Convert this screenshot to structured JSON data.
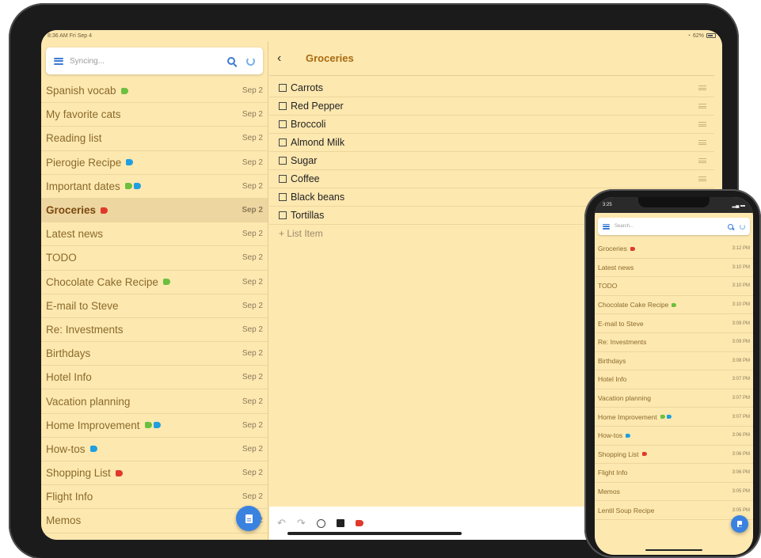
{
  "tablet": {
    "status": {
      "time": "8:36 AM  Fri Sep 4",
      "battery": "62%"
    },
    "search": {
      "placeholder": "Syncing..."
    },
    "notes": [
      {
        "title": "Spanish vocab",
        "date": "Sep 2",
        "tags": [
          "#6cbf3f"
        ]
      },
      {
        "title": "My favorite cats",
        "date": "Sep 2",
        "tags": []
      },
      {
        "title": "Reading list",
        "date": "Sep 2",
        "tags": []
      },
      {
        "title": "Pierogie Recipe",
        "date": "Sep 2",
        "tags": [
          "#1f9fe0"
        ]
      },
      {
        "title": "Important dates",
        "date": "Sep 2",
        "tags": [
          "#6cbf3f",
          "#1f9fe0"
        ]
      },
      {
        "title": "Groceries",
        "date": "Sep 2",
        "tags": [
          "#e0392b"
        ],
        "selected": true
      },
      {
        "title": "Latest news",
        "date": "Sep 2",
        "tags": []
      },
      {
        "title": "TODO",
        "date": "Sep 2",
        "tags": []
      },
      {
        "title": "Chocolate Cake Recipe",
        "date": "Sep 2",
        "tags": [
          "#6cbf3f"
        ]
      },
      {
        "title": "E-mail to Steve",
        "date": "Sep 2",
        "tags": []
      },
      {
        "title": "Re: Investments",
        "date": "Sep 2",
        "tags": []
      },
      {
        "title": "Birthdays",
        "date": "Sep 2",
        "tags": []
      },
      {
        "title": "Hotel Info",
        "date": "Sep 2",
        "tags": []
      },
      {
        "title": "Vacation planning",
        "date": "Sep 2",
        "tags": []
      },
      {
        "title": "Home Improvement",
        "date": "Sep 2",
        "tags": [
          "#6cbf3f",
          "#1f9fe0"
        ]
      },
      {
        "title": "How-tos",
        "date": "Sep 2",
        "tags": [
          "#1f9fe0"
        ]
      },
      {
        "title": "Shopping List",
        "date": "Sep 2",
        "tags": [
          "#e0392b"
        ]
      },
      {
        "title": "Flight Info",
        "date": "Sep 2",
        "tags": []
      },
      {
        "title": "Memos",
        "date": "Sep 2",
        "tags": []
      }
    ],
    "editor": {
      "back_icon": "chevron-left-icon",
      "title": "Groceries",
      "items": [
        "Carrots",
        "Red Pepper",
        "Broccoli",
        "Almond Milk",
        "Sugar",
        "Coffee",
        "Black beans",
        "Tortillas"
      ],
      "add_item_label": "+ List Item",
      "toolbar": {
        "undo": "↶",
        "redo": "↷"
      }
    }
  },
  "phone": {
    "status": {
      "time": "3:25"
    },
    "search": {
      "placeholder": "Search..."
    },
    "notes": [
      {
        "title": "Groceries",
        "date": "3:12 PM",
        "tags": [
          "#e0392b"
        ]
      },
      {
        "title": "Latest news",
        "date": "3:10 PM",
        "tags": []
      },
      {
        "title": "TODO",
        "date": "3:10 PM",
        "tags": []
      },
      {
        "title": "Chocolate Cake Recipe",
        "date": "3:10 PM",
        "tags": [
          "#6cbf3f"
        ]
      },
      {
        "title": "E-mail to Steve",
        "date": "3:09 PM",
        "tags": []
      },
      {
        "title": "Re: Investments",
        "date": "3:09 PM",
        "tags": []
      },
      {
        "title": "Birthdays",
        "date": "3:08 PM",
        "tags": []
      },
      {
        "title": "Hotel Info",
        "date": "3:07 PM",
        "tags": []
      },
      {
        "title": "Vacation planning",
        "date": "3:07 PM",
        "tags": []
      },
      {
        "title": "Home Improvement",
        "date": "3:07 PM",
        "tags": [
          "#6cbf3f",
          "#1f9fe0"
        ]
      },
      {
        "title": "How-tos",
        "date": "3:06 PM",
        "tags": [
          "#1f9fe0"
        ]
      },
      {
        "title": "Shopping List",
        "date": "3:06 PM",
        "tags": [
          "#e0392b"
        ]
      },
      {
        "title": "Flight Info",
        "date": "3:06 PM",
        "tags": []
      },
      {
        "title": "Memos",
        "date": "3:05 PM",
        "tags": []
      },
      {
        "title": "Lentil Soup Recipe",
        "date": "3:05 PM",
        "tags": []
      }
    ]
  }
}
